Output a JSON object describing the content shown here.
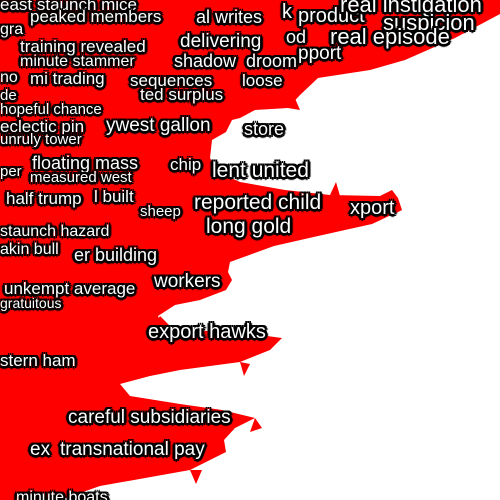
{
  "colors": {
    "background": "#ffffff",
    "shape_fill": "#ff0000",
    "text": "#ffffff",
    "text_outline": "#000000"
  },
  "labels": [
    "east staunch mice",
    "peaked members",
    "al writes",
    "k",
    "product",
    "real instigation",
    "suspicion",
    "gra",
    "training revealed",
    "delivering",
    "od",
    "real episode",
    "pport",
    "minute stammer",
    "shadow",
    "droom",
    "no",
    "mi trading",
    "sequences",
    "loose",
    "de",
    "ted surplus",
    "hopeful chance",
    "eclectic pin",
    "ywest gallon",
    "store",
    "unruly tower",
    "floating mass",
    "chip",
    "lent united",
    "per",
    "measured west",
    "half trump",
    "l built",
    "reported child",
    "xport",
    "sheep",
    "staunch hazard",
    "long gold",
    "akin bull",
    "er building",
    "workers",
    "unkempt average",
    "gratuitous",
    "export hawks",
    "stern ham",
    "careful subsidiaries",
    "ex",
    "transnational pay",
    "minute boats"
  ]
}
